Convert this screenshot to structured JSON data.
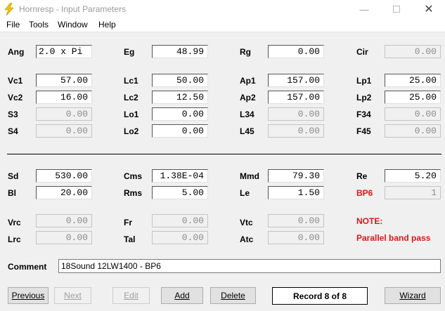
{
  "window": {
    "title": "Hornresp - Input Parameters"
  },
  "menu": [
    "File",
    "Tools",
    "Window",
    "Help"
  ],
  "params": {
    "ang": {
      "label": "Ang",
      "value": "2.0 x Pi"
    },
    "eg": {
      "label": "Eg",
      "value": "48.99"
    },
    "rg": {
      "label": "Rg",
      "value": "0.00"
    },
    "cir": {
      "label": "Cir",
      "value": "0.00"
    },
    "vc1": {
      "label": "Vc1",
      "value": "57.00"
    },
    "lc1": {
      "label": "Lc1",
      "value": "50.00"
    },
    "ap1": {
      "label": "Ap1",
      "value": "157.00"
    },
    "lp1": {
      "label": "Lp1",
      "value": "25.00"
    },
    "vc2": {
      "label": "Vc2",
      "value": "16.00"
    },
    "lc2": {
      "label": "Lc2",
      "value": "12.50"
    },
    "ap2": {
      "label": "Ap2",
      "value": "157.00"
    },
    "lp2": {
      "label": "Lp2",
      "value": "25.00"
    },
    "s3": {
      "label": "S3",
      "value": "0.00"
    },
    "lo1": {
      "label": "Lo1",
      "value": "0.00"
    },
    "l34": {
      "label": "L34",
      "value": "0.00"
    },
    "f34": {
      "label": "F34",
      "value": "0.00"
    },
    "s4": {
      "label": "S4",
      "value": "0.00"
    },
    "lo2": {
      "label": "Lo2",
      "value": "0.00"
    },
    "l45": {
      "label": "L45",
      "value": "0.00"
    },
    "f45": {
      "label": "F45",
      "value": "0.00"
    },
    "sd": {
      "label": "Sd",
      "value": "530.00"
    },
    "cms": {
      "label": "Cms",
      "value": "1.38E-04"
    },
    "mmd": {
      "label": "Mmd",
      "value": "79.30"
    },
    "re": {
      "label": "Re",
      "value": "5.20"
    },
    "bl": {
      "label": "Bl",
      "value": "20.00"
    },
    "rms": {
      "label": "Rms",
      "value": "5.00"
    },
    "le": {
      "label": "Le",
      "value": "1.50"
    },
    "bp6": {
      "label": "BP6",
      "value": "1"
    },
    "vrc": {
      "label": "Vrc",
      "value": "0.00"
    },
    "fr": {
      "label": "Fr",
      "value": "0.00"
    },
    "vtc": {
      "label": "Vtc",
      "value": "0.00"
    },
    "lrc": {
      "label": "Lrc",
      "value": "0.00"
    },
    "tal": {
      "label": "Tal",
      "value": "0.00"
    },
    "atc": {
      "label": "Atc",
      "value": "0.00"
    }
  },
  "note": {
    "title": "NOTE:",
    "text": "Parallel band pass"
  },
  "comment": {
    "label": "Comment",
    "value": "18Sound 12LW1400 - BP6"
  },
  "buttons": {
    "previous": "Previous",
    "next": "Next",
    "edit": "Edit",
    "add": "Add",
    "delete": "Delete",
    "wizard": "Wizard"
  },
  "record": "Record 8 of 8",
  "colors": {
    "accent_red": "#d81818",
    "icon_yellow": "#f0c400"
  }
}
